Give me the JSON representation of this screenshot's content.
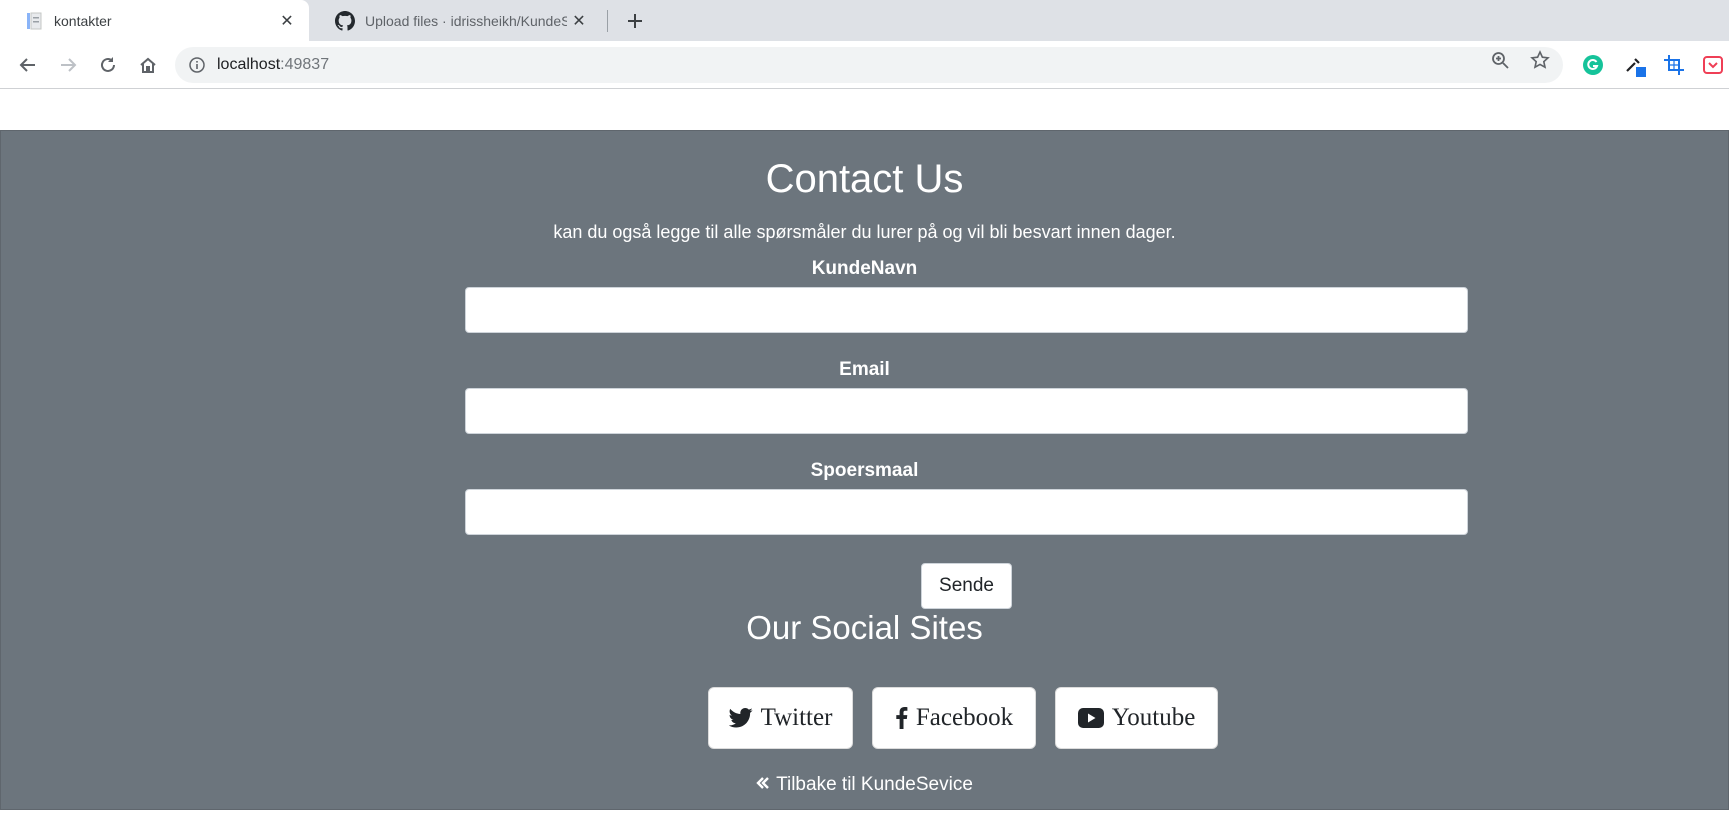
{
  "browser": {
    "tabs": [
      {
        "title": "kontakter",
        "active": true,
        "icon": "document-icon"
      },
      {
        "title": "Upload files · idrissheikh/KundeS",
        "active": false,
        "icon": "github-icon"
      }
    ],
    "address": {
      "host": "localhost",
      "port": ":49837"
    }
  },
  "contact": {
    "heading": "Contact Us",
    "subtext": "kan du også legge til alle spørsmåler du lurer på og vil bli besvart innen dager.",
    "fields": [
      {
        "label": "KundeNavn",
        "value": ""
      },
      {
        "label": "Email",
        "value": ""
      },
      {
        "label": "Spoersmaal",
        "value": ""
      }
    ],
    "submit_label": "Sende"
  },
  "social": {
    "heading": "Our Social Sites",
    "buttons": [
      {
        "label": "Twitter",
        "icon": "twitter-icon"
      },
      {
        "label": "Facebook",
        "icon": "facebook-icon"
      },
      {
        "label": "Youtube",
        "icon": "youtube-icon"
      }
    ]
  },
  "back_link": {
    "label": "Tilbake til KundeSevice",
    "icon": "double-chevron-left-icon"
  },
  "colors": {
    "section_bg": "#6c757d",
    "text": "#ffffff"
  }
}
